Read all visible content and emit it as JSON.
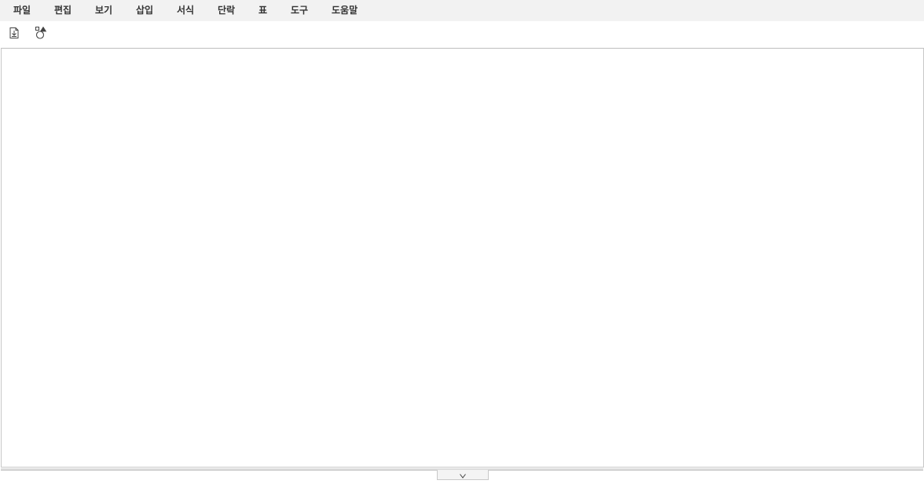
{
  "menubar": {
    "items": [
      {
        "label": "파일"
      },
      {
        "label": "편집"
      },
      {
        "label": "보기"
      },
      {
        "label": "삽입"
      },
      {
        "label": "서식"
      },
      {
        "label": "단락"
      },
      {
        "label": "표"
      },
      {
        "label": "도구"
      },
      {
        "label": "도움말"
      }
    ]
  },
  "toolbar": {
    "buttons": [
      {
        "icon": "import-document-icon"
      },
      {
        "icon": "shapes-icon"
      }
    ]
  },
  "colors": {
    "menubar_bg": "#f2f2f2",
    "menu_text": "#333333",
    "border": "#c8c8c8"
  }
}
